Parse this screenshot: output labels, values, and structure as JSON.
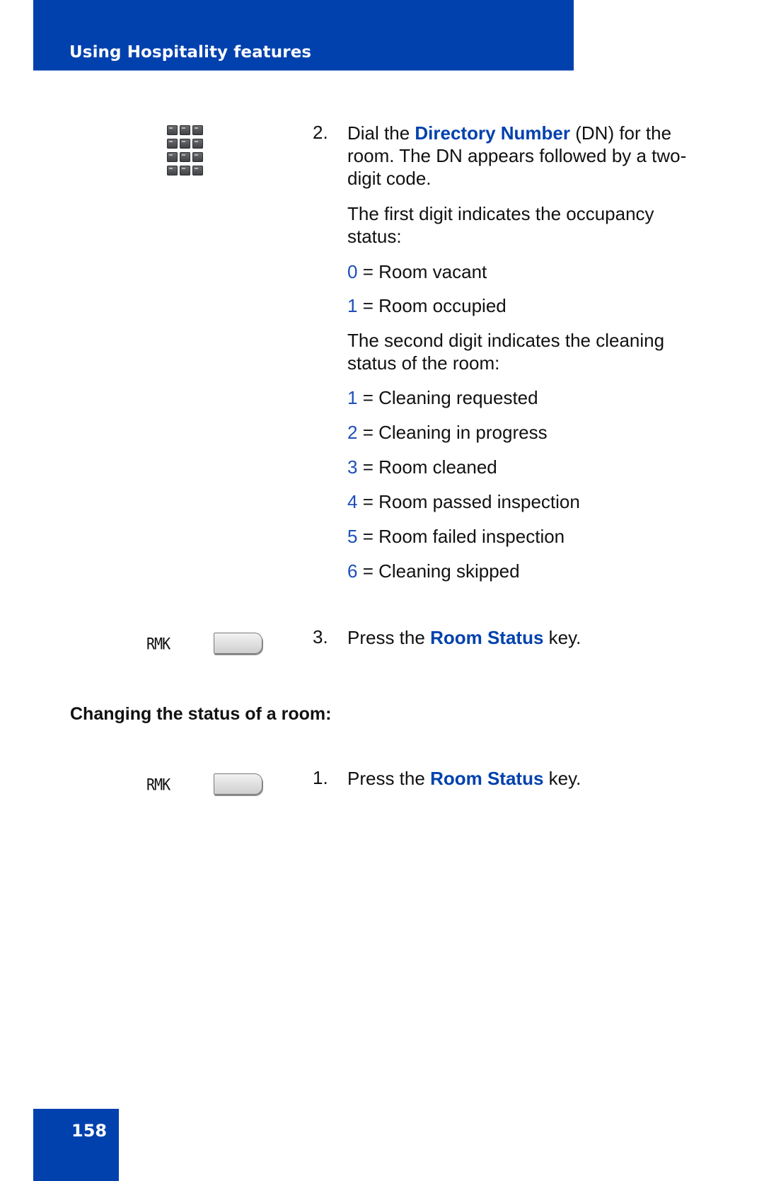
{
  "header": {
    "title": "Using Hospitality features"
  },
  "page_number": "158",
  "colors": {
    "brand_blue": "#0041ad",
    "highlight_blue": "#0041ad",
    "digit_blue": "#1d4fb8"
  },
  "step2": {
    "number": "2.",
    "icon": "dialpad-icon",
    "text_before": "Dial the ",
    "highlight": "Directory Number",
    "text_after": " (DN) for the room. The DN appears followed by a two-digit code.",
    "first_digit_intro": "The first digit indicates the occupancy status:",
    "occupancy_codes": [
      {
        "digit": "0",
        "meaning": " = Room vacant"
      },
      {
        "digit": "1",
        "meaning": " = Room occupied"
      }
    ],
    "second_digit_intro": "The second digit indicates the cleaning status of the room:",
    "cleaning_codes": [
      {
        "digit": "1",
        "meaning": " = Cleaning requested"
      },
      {
        "digit": "2",
        "meaning": " = Cleaning in progress"
      },
      {
        "digit": "3",
        "meaning": " = Room cleaned"
      },
      {
        "digit": "4",
        "meaning": " = Room passed inspection"
      },
      {
        "digit": "5",
        "meaning": " = Room failed inspection"
      },
      {
        "digit": "6",
        "meaning": " = Cleaning skipped"
      }
    ]
  },
  "step3": {
    "number": "3.",
    "softkey_label": "RMK",
    "text_before": "Press the ",
    "highlight": "Room Status",
    "text_after": " key."
  },
  "section": {
    "heading": "Changing the status of a room:"
  },
  "change_step1": {
    "number": "1.",
    "softkey_label": "RMK",
    "text_before": "Press the ",
    "highlight": "Room Status",
    "text_after": " key."
  }
}
